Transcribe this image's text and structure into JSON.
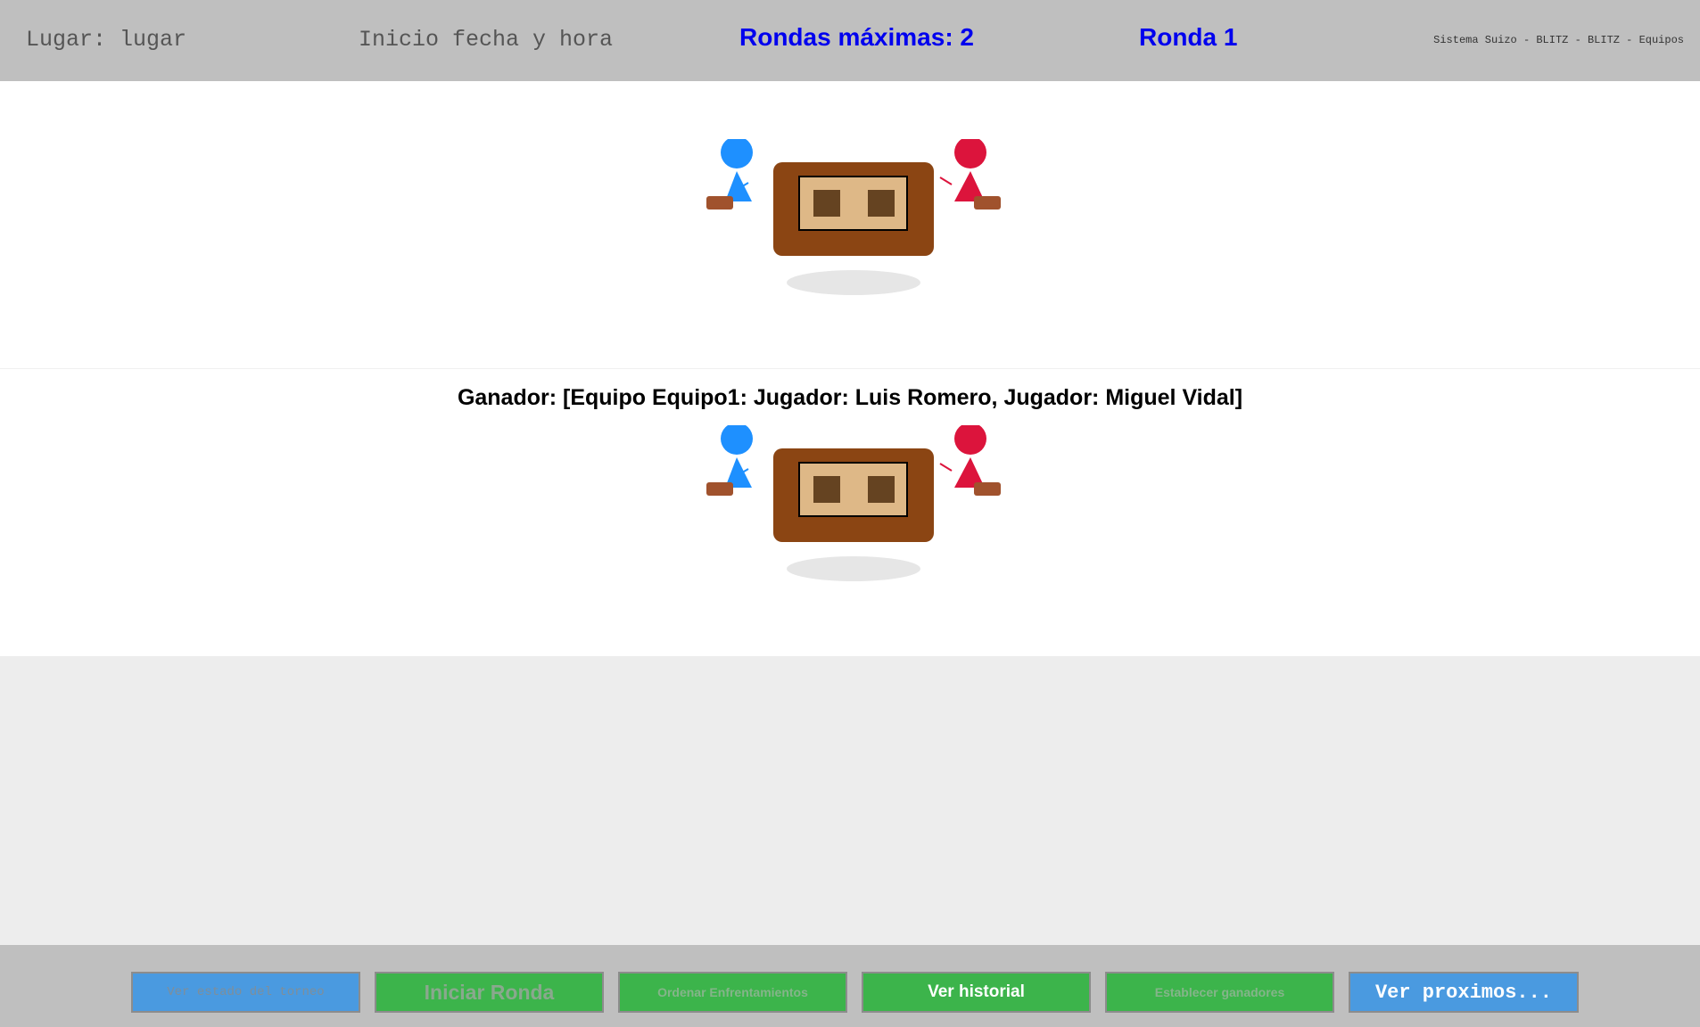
{
  "header": {
    "lugar": "Lugar: lugar",
    "inicio": "Inicio fecha y hora",
    "rondas_maximas": "Rondas máximas: 2",
    "ronda": "Ronda 1",
    "sistema": "Sistema Suizo - BLITZ - BLITZ - Equipos"
  },
  "matches": [
    {
      "winner": ""
    },
    {
      "winner": "Ganador: [Equipo Equipo1: Jugador: Luis Romero, Jugador: Miguel Vidal]"
    }
  ],
  "footer": {
    "buttons": [
      {
        "label": "Ver estado del torneo"
      },
      {
        "label": "Iniciar Ronda"
      },
      {
        "label": "Ordenar Enfrentamientos"
      },
      {
        "label": "Ver historial"
      },
      {
        "label": "Establecer ganadores"
      },
      {
        "label": "Ver proximos..."
      }
    ]
  },
  "colors": {
    "header_bg": "#bfbfbf",
    "accent_blue_text": "#0000ee",
    "player_blue": "#1e90ff",
    "player_red": "#dc143c",
    "table_brown": "#8b4513",
    "board_tan": "#deb887",
    "button_blue": "#4a9ae0",
    "button_green": "#3cb44b"
  },
  "icons": [
    "player-blue-icon",
    "player-red-icon",
    "chess-table-icon"
  ]
}
